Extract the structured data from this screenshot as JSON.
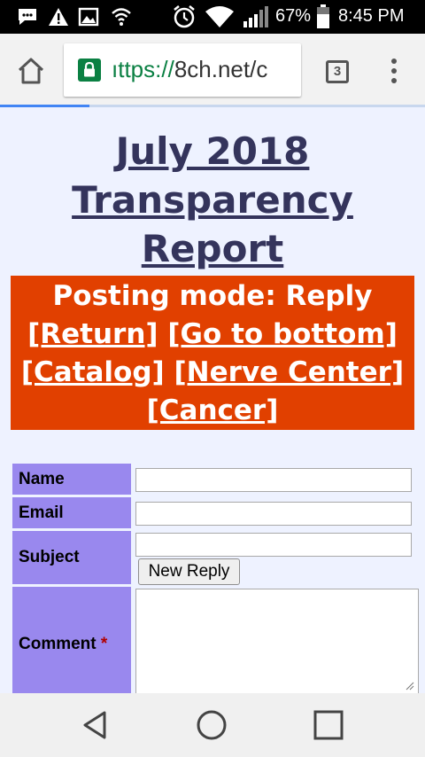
{
  "status_bar": {
    "battery": "67%",
    "time": "8:45 PM",
    "icons": [
      "message-icon",
      "warning-icon",
      "image-icon",
      "hotspot-icon",
      "alarm-icon",
      "wifi-icon",
      "signal-icon",
      "battery-icon"
    ]
  },
  "browser": {
    "url_scheme": "ıttps://",
    "url_host": "8ch.net/c",
    "tab_count": "3",
    "load_progress": 0.21,
    "accent": "#4285f4"
  },
  "page": {
    "title_lines": [
      "July 2018",
      "Transparency",
      "Report"
    ],
    "banner": {
      "mode": "Posting mode: Reply",
      "links": [
        "[Return]",
        "[Go to bottom]",
        "[Catalog]",
        "[Nerve Center]",
        "[Cancer]"
      ],
      "color": "#e14000"
    },
    "form": {
      "name_label": "Name",
      "email_label": "Email",
      "subject_label": "Subject",
      "comment_label": "Comment",
      "required_mark": "*",
      "submit_label": "New Reply",
      "name_value": "",
      "email_value": "",
      "subject_value": "",
      "comment_value": "",
      "label_color": "#9988ee"
    }
  },
  "nav_bar": {
    "buttons": [
      "back-icon",
      "home-circle-icon",
      "recents-icon"
    ]
  }
}
